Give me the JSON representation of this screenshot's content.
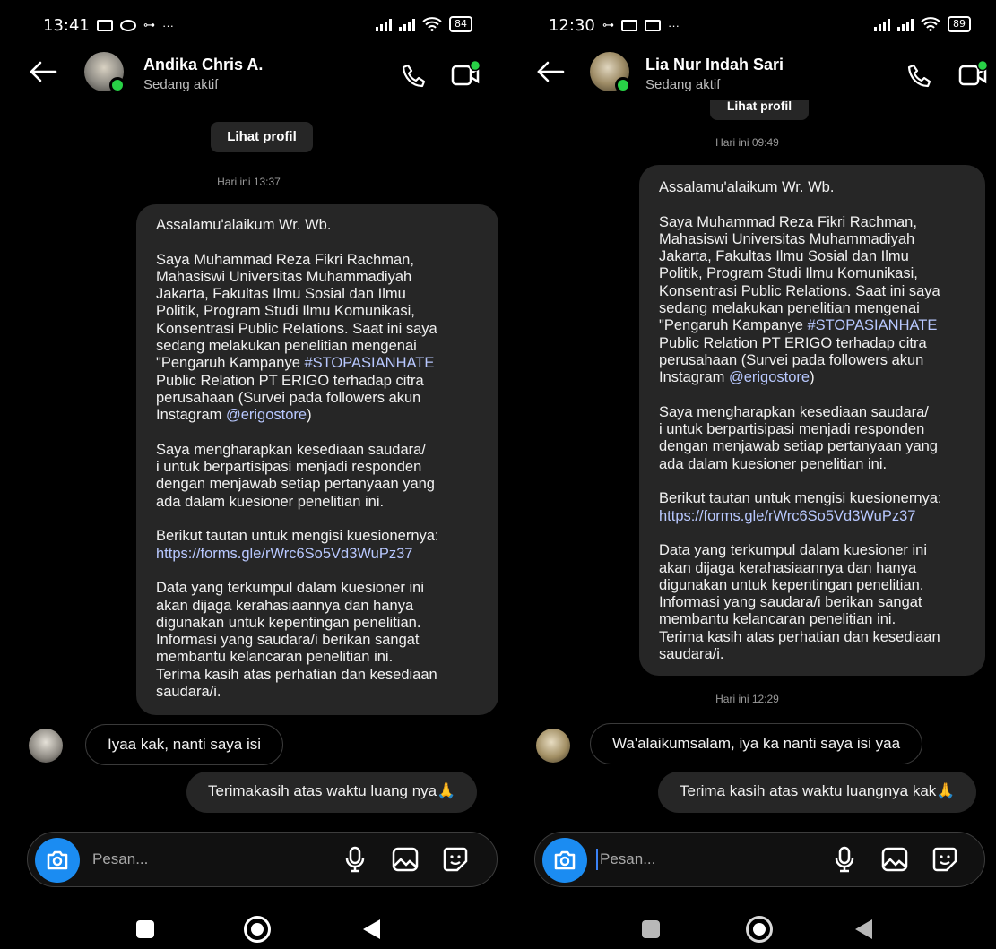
{
  "left": {
    "status": {
      "time": "13:41",
      "battery": "84",
      "more": "···"
    },
    "header": {
      "name": "Andika Chris A.",
      "status": "Sedang aktif"
    },
    "profile_button": "Lihat profil",
    "timestamp_1": "Hari ini 13:37",
    "message": {
      "p1": "Assalamu'alaikum Wr. Wb.",
      "p2a": "Saya Muhammad Reza Fikri Rachman,\nMahasiswi Universitas Muhammadiyah\nJakarta, Fakultas Ilmu Sosial dan Ilmu\nPolitik, Program Studi Ilmu Komunikasi,\nKonsentrasi Public Relations. Saat ini saya\nsedang melakukan penelitian mengenai\n\"Pengaruh Kampanye ",
      "hashtag": "#STOPASIANHATE",
      "p2b": "\nPublic Relation PT ERIGO terhadap citra\nperusahaan (Survei pada followers akun\nInstagram ",
      "mention": "@erigostore",
      "p2c": ")",
      "p3": "Saya mengharapkan kesediaan saudara/\ni untuk berpartisipasi menjadi responden\ndengan menjawab setiap pertanyaan yang\nada dalam kuesioner penelitian ini.",
      "p4": "Berikut tautan untuk mengisi kuesionernya:",
      "url": "https://forms.gle/rWrc6So5Vd3WuPz37",
      "p5": "Data yang terkumpul dalam kuesioner ini\nakan dijaga kerahasiaannya dan hanya\ndigunakan untuk kepentingan penelitian.\nInformasi yang saudara/i berikan sangat\nmembantu kelancaran penelitian ini.\nTerima kasih atas perhatian dan kesediaan\nsaudara/i."
    },
    "reply": "Iyaa kak, nanti saya isi",
    "sent": "Terimakasih atas waktu luang nya🙏",
    "input_placeholder": "Pesan..."
  },
  "right": {
    "status": {
      "time": "12:30",
      "battery": "89",
      "more": "···"
    },
    "header": {
      "name": "Lia Nur Indah Sari",
      "status": "Sedang aktif"
    },
    "profile_button": "Lihat profil",
    "timestamp_1": "Hari ini 09:49",
    "message": {
      "p1": "Assalamu'alaikum Wr. Wb.",
      "p2a": "Saya Muhammad Reza Fikri Rachman,\nMahasiswi Universitas Muhammadiyah\nJakarta, Fakultas Ilmu Sosial dan Ilmu\nPolitik, Program Studi Ilmu Komunikasi,\nKonsentrasi Public Relations. Saat ini saya\nsedang melakukan penelitian mengenai\n\"Pengaruh Kampanye ",
      "hashtag": "#STOPASIANHATE",
      "p2b": "\nPublic Relation PT ERIGO terhadap citra\nperusahaan (Survei pada followers akun\nInstagram ",
      "mention": "@erigostore",
      "p2c": ")",
      "p3": "Saya mengharapkan kesediaan saudara/\ni untuk berpartisipasi menjadi responden\ndengan menjawab setiap pertanyaan yang\nada dalam kuesioner penelitian ini.",
      "p4": "Berikut tautan untuk mengisi kuesionernya:",
      "url": "https://forms.gle/rWrc6So5Vd3WuPz37",
      "p5": "Data yang terkumpul dalam kuesioner ini\nakan dijaga kerahasiaannya dan hanya\ndigunakan untuk kepentingan penelitian.\nInformasi yang saudara/i berikan sangat\nmembantu kelancaran penelitian ini.\nTerima kasih atas perhatian dan kesediaan\nsaudara/i."
    },
    "timestamp_2": "Hari ini 12:29",
    "reply": "Wa'alaikumsalam, iya ka nanti saya isi yaa",
    "sent": "Terima kasih atas waktu luangnya kak🙏",
    "input_placeholder": "Pesan..."
  },
  "colors": {
    "bubble": "#262626",
    "online": "#28d146",
    "camera": "#1b8cf2",
    "link": "#b8c8ff"
  }
}
